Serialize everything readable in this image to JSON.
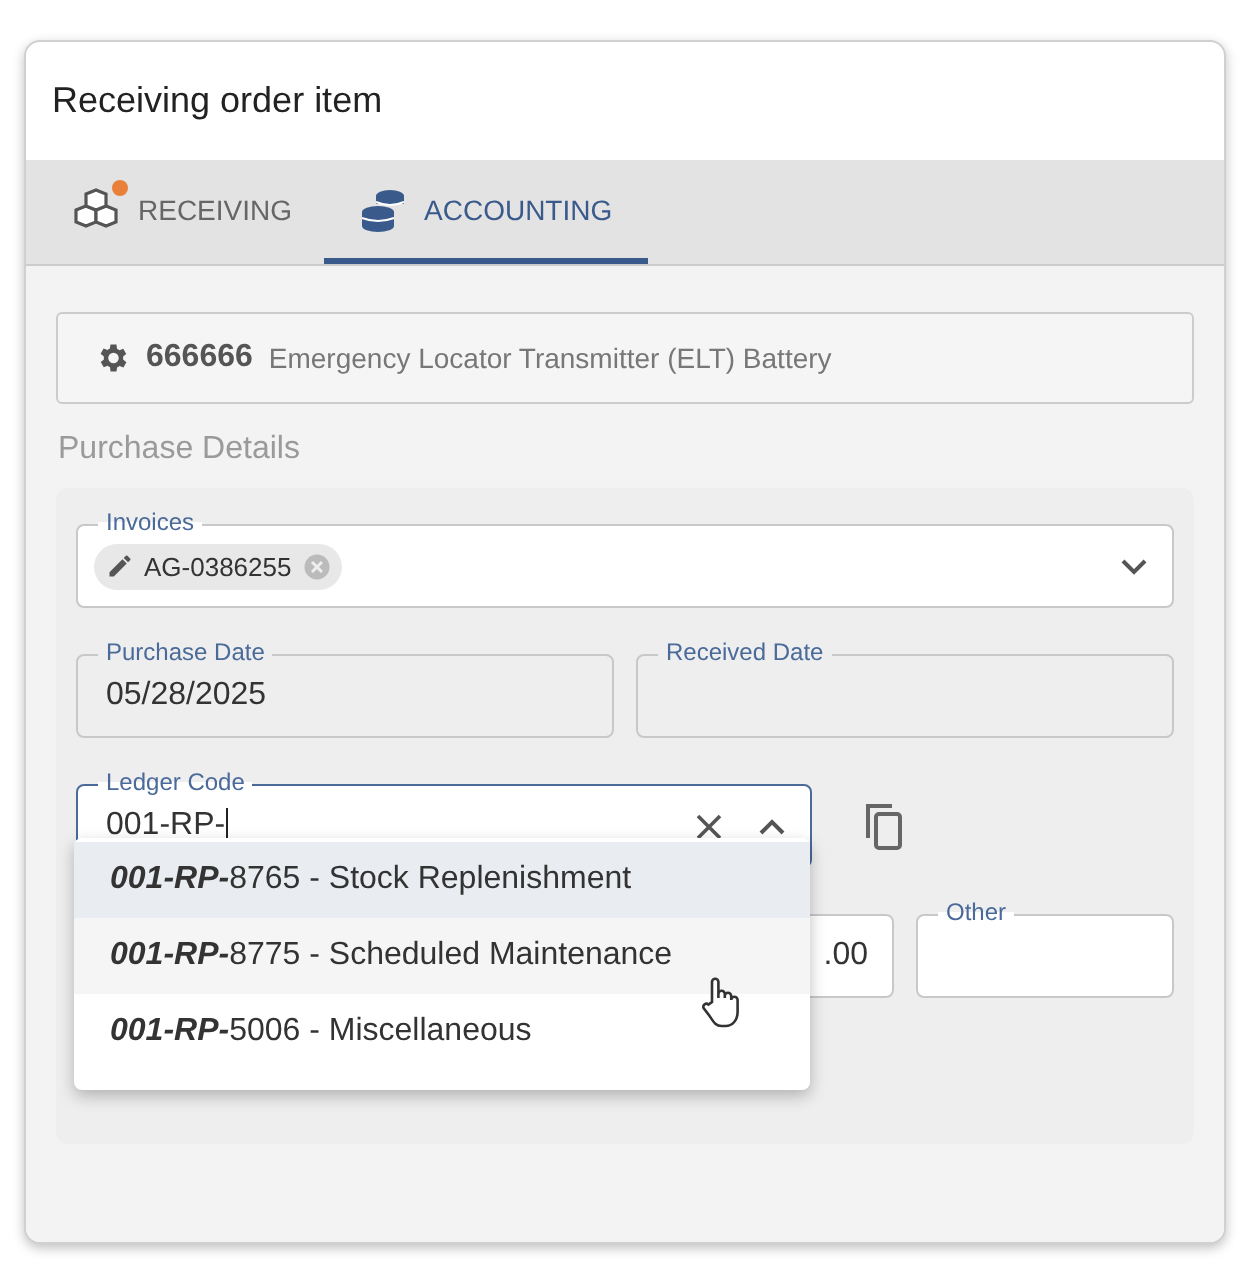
{
  "window": {
    "title": "Receiving order item"
  },
  "tabs": [
    {
      "label": "RECEIVING",
      "notification": true,
      "selected": false
    },
    {
      "label": "ACCOUNTING",
      "notification": false,
      "selected": true
    }
  ],
  "item": {
    "code": "666666",
    "description": "Emergency Locator Transmitter (ELT) Battery"
  },
  "section_title": "Purchase Details",
  "invoices": {
    "label": "Invoices",
    "chips": [
      {
        "label": "AG-0386255"
      }
    ]
  },
  "dates": [
    {
      "label": "Purchase Date",
      "value": "05/28/2025",
      "disabled": true
    },
    {
      "label": "Received Date",
      "disabled": true
    }
  ],
  "ledger_code": {
    "label": "Ledger Code",
    "value": "001-RP-",
    "focused": true,
    "expanded": true
  },
  "ledger_options": [
    {
      "text": "**001-RP-**8765 - Stock Replenishment",
      "selected": true,
      "hovered": false
    },
    {
      "text": "**001-RP-**8775 - Scheduled Maintenance",
      "selected": false,
      "hovered": true
    },
    {
      "text": "**001-RP-**5006 - Miscellaneous",
      "selected": false,
      "hovered": false
    }
  ],
  "amounts": [
    {
      "value": ".00"
    },
    {
      "label": "Other"
    }
  ]
}
